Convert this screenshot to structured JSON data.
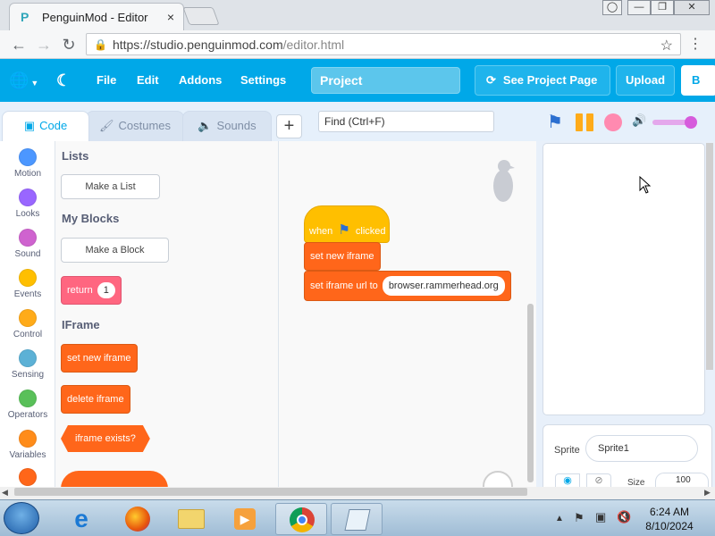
{
  "browser": {
    "tab_title": "PenguinMod - Editor",
    "tab_close": "×",
    "url_host": "https://studio.penguinmod.com",
    "url_path": "/editor.html",
    "window_buttons": [
      "user-icon",
      "minimize-icon",
      "restore-icon",
      "close-icon"
    ]
  },
  "menubar": {
    "file": "File",
    "edit": "Edit",
    "addons": "Addons",
    "settings": "Settings",
    "project_title": "Project",
    "see_project_page": "See Project Page",
    "upload": "Upload",
    "cut_button": "B",
    "bg_color": "#00a8e8"
  },
  "editor_tabs": {
    "code": "Code",
    "costumes": "Costumes",
    "sounds": "Sounds",
    "add": "+",
    "find_placeholder": "Find (Ctrl+F)"
  },
  "categories": [
    {
      "label": "Motion",
      "color": "#4c97ff"
    },
    {
      "label": "Looks",
      "color": "#9966ff"
    },
    {
      "label": "Sound",
      "color": "#cf63cf"
    },
    {
      "label": "Events",
      "color": "#ffbf00"
    },
    {
      "label": "Control",
      "color": "#ffab19"
    },
    {
      "label": "Sensing",
      "color": "#5cb1d6"
    },
    {
      "label": "Operators",
      "color": "#59c059"
    },
    {
      "label": "Variables",
      "color": "#ff8c1a"
    }
  ],
  "palette": {
    "lists_heading": "Lists",
    "make_list": "Make a List",
    "myblocks_heading": "My Blocks",
    "make_block": "Make a Block",
    "return_label": "return",
    "return_value": "1",
    "iframe_heading": "IFrame",
    "set_new_iframe": "set new iframe",
    "delete_iframe": "delete iframe",
    "iframe_exists": "iframe exists?"
  },
  "script": {
    "hat_when": "when",
    "hat_clicked": "clicked",
    "block1": "set new iframe",
    "block2_label": "set iframe url to",
    "block2_value": "browser.rammerhead.org"
  },
  "sprite": {
    "label": "Sprite",
    "name": "Sprite1",
    "size_label": "Size",
    "size_value": "100"
  },
  "taskbar": {
    "time": "6:24 AM",
    "date": "8/10/2024"
  }
}
